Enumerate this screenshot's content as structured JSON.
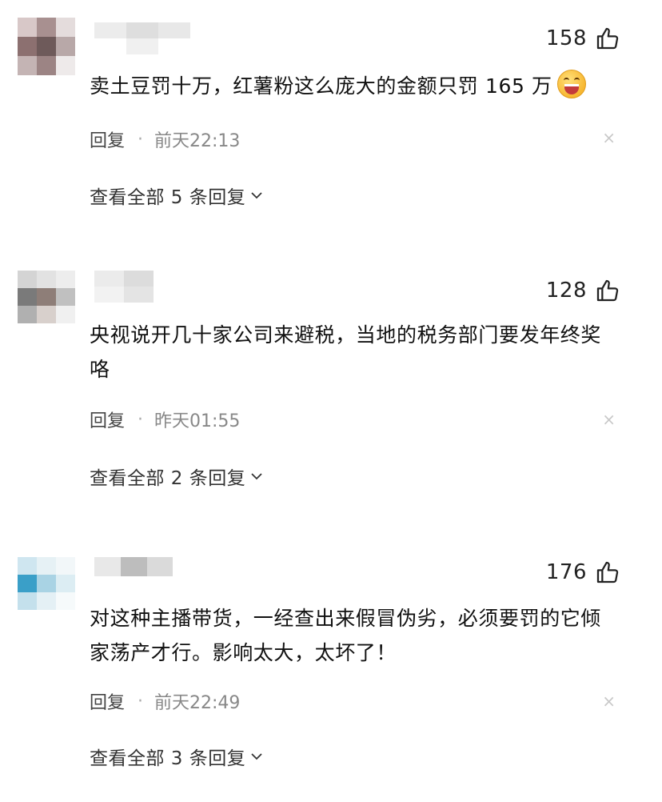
{
  "comments": [
    {
      "likes": "158",
      "text": "卖土豆罚十万，红薯粉这么庞大的金额只罚 165 万",
      "emoji": "grinning-face-emoji",
      "reply_label": "回复",
      "separator": "·",
      "time": "前天22:13",
      "close": "×",
      "expand_label": "查看全部 5 条回复"
    },
    {
      "likes": "128",
      "text": "央视说开几十家公司来避税，当地的税务部门要发年终奖咯",
      "reply_label": "回复",
      "separator": "·",
      "time": "昨天01:55",
      "close": "×",
      "expand_label": "查看全部 2 条回复"
    },
    {
      "likes": "176",
      "text": "对这种主播带货，一经查出来假冒伪劣，必须要罚的它倾家荡产才行。影响太大，太坏了！",
      "reply_label": "回复",
      "separator": "·",
      "time": "前天22:49",
      "close": "×",
      "expand_label": "查看全部 3 条回复"
    }
  ],
  "icons": {
    "like": "thumbs-up-icon",
    "close": "close-icon",
    "expand": "chevron-down-icon"
  }
}
